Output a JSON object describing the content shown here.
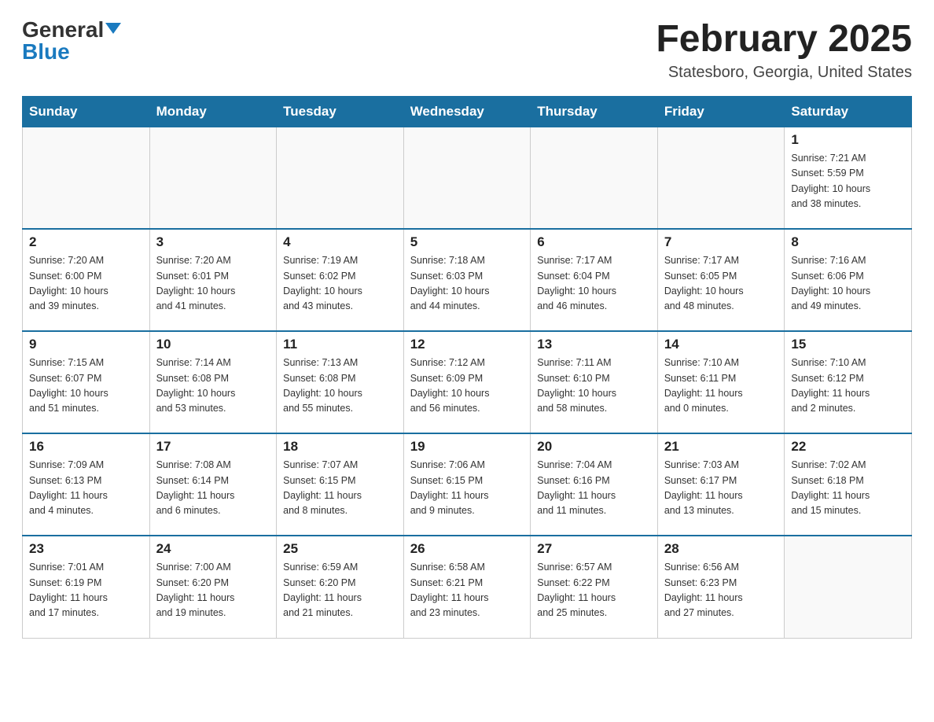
{
  "header": {
    "logo_general": "General",
    "logo_blue": "Blue",
    "title": "February 2025",
    "subtitle": "Statesboro, Georgia, United States"
  },
  "weekdays": [
    "Sunday",
    "Monday",
    "Tuesday",
    "Wednesday",
    "Thursday",
    "Friday",
    "Saturday"
  ],
  "weeks": [
    [
      {
        "day": "",
        "info": ""
      },
      {
        "day": "",
        "info": ""
      },
      {
        "day": "",
        "info": ""
      },
      {
        "day": "",
        "info": ""
      },
      {
        "day": "",
        "info": ""
      },
      {
        "day": "",
        "info": ""
      },
      {
        "day": "1",
        "info": "Sunrise: 7:21 AM\nSunset: 5:59 PM\nDaylight: 10 hours\nand 38 minutes."
      }
    ],
    [
      {
        "day": "2",
        "info": "Sunrise: 7:20 AM\nSunset: 6:00 PM\nDaylight: 10 hours\nand 39 minutes."
      },
      {
        "day": "3",
        "info": "Sunrise: 7:20 AM\nSunset: 6:01 PM\nDaylight: 10 hours\nand 41 minutes."
      },
      {
        "day": "4",
        "info": "Sunrise: 7:19 AM\nSunset: 6:02 PM\nDaylight: 10 hours\nand 43 minutes."
      },
      {
        "day": "5",
        "info": "Sunrise: 7:18 AM\nSunset: 6:03 PM\nDaylight: 10 hours\nand 44 minutes."
      },
      {
        "day": "6",
        "info": "Sunrise: 7:17 AM\nSunset: 6:04 PM\nDaylight: 10 hours\nand 46 minutes."
      },
      {
        "day": "7",
        "info": "Sunrise: 7:17 AM\nSunset: 6:05 PM\nDaylight: 10 hours\nand 48 minutes."
      },
      {
        "day": "8",
        "info": "Sunrise: 7:16 AM\nSunset: 6:06 PM\nDaylight: 10 hours\nand 49 minutes."
      }
    ],
    [
      {
        "day": "9",
        "info": "Sunrise: 7:15 AM\nSunset: 6:07 PM\nDaylight: 10 hours\nand 51 minutes."
      },
      {
        "day": "10",
        "info": "Sunrise: 7:14 AM\nSunset: 6:08 PM\nDaylight: 10 hours\nand 53 minutes."
      },
      {
        "day": "11",
        "info": "Sunrise: 7:13 AM\nSunset: 6:08 PM\nDaylight: 10 hours\nand 55 minutes."
      },
      {
        "day": "12",
        "info": "Sunrise: 7:12 AM\nSunset: 6:09 PM\nDaylight: 10 hours\nand 56 minutes."
      },
      {
        "day": "13",
        "info": "Sunrise: 7:11 AM\nSunset: 6:10 PM\nDaylight: 10 hours\nand 58 minutes."
      },
      {
        "day": "14",
        "info": "Sunrise: 7:10 AM\nSunset: 6:11 PM\nDaylight: 11 hours\nand 0 minutes."
      },
      {
        "day": "15",
        "info": "Sunrise: 7:10 AM\nSunset: 6:12 PM\nDaylight: 11 hours\nand 2 minutes."
      }
    ],
    [
      {
        "day": "16",
        "info": "Sunrise: 7:09 AM\nSunset: 6:13 PM\nDaylight: 11 hours\nand 4 minutes."
      },
      {
        "day": "17",
        "info": "Sunrise: 7:08 AM\nSunset: 6:14 PM\nDaylight: 11 hours\nand 6 minutes."
      },
      {
        "day": "18",
        "info": "Sunrise: 7:07 AM\nSunset: 6:15 PM\nDaylight: 11 hours\nand 8 minutes."
      },
      {
        "day": "19",
        "info": "Sunrise: 7:06 AM\nSunset: 6:15 PM\nDaylight: 11 hours\nand 9 minutes."
      },
      {
        "day": "20",
        "info": "Sunrise: 7:04 AM\nSunset: 6:16 PM\nDaylight: 11 hours\nand 11 minutes."
      },
      {
        "day": "21",
        "info": "Sunrise: 7:03 AM\nSunset: 6:17 PM\nDaylight: 11 hours\nand 13 minutes."
      },
      {
        "day": "22",
        "info": "Sunrise: 7:02 AM\nSunset: 6:18 PM\nDaylight: 11 hours\nand 15 minutes."
      }
    ],
    [
      {
        "day": "23",
        "info": "Sunrise: 7:01 AM\nSunset: 6:19 PM\nDaylight: 11 hours\nand 17 minutes."
      },
      {
        "day": "24",
        "info": "Sunrise: 7:00 AM\nSunset: 6:20 PM\nDaylight: 11 hours\nand 19 minutes."
      },
      {
        "day": "25",
        "info": "Sunrise: 6:59 AM\nSunset: 6:20 PM\nDaylight: 11 hours\nand 21 minutes."
      },
      {
        "day": "26",
        "info": "Sunrise: 6:58 AM\nSunset: 6:21 PM\nDaylight: 11 hours\nand 23 minutes."
      },
      {
        "day": "27",
        "info": "Sunrise: 6:57 AM\nSunset: 6:22 PM\nDaylight: 11 hours\nand 25 minutes."
      },
      {
        "day": "28",
        "info": "Sunrise: 6:56 AM\nSunset: 6:23 PM\nDaylight: 11 hours\nand 27 minutes."
      },
      {
        "day": "",
        "info": ""
      }
    ]
  ]
}
